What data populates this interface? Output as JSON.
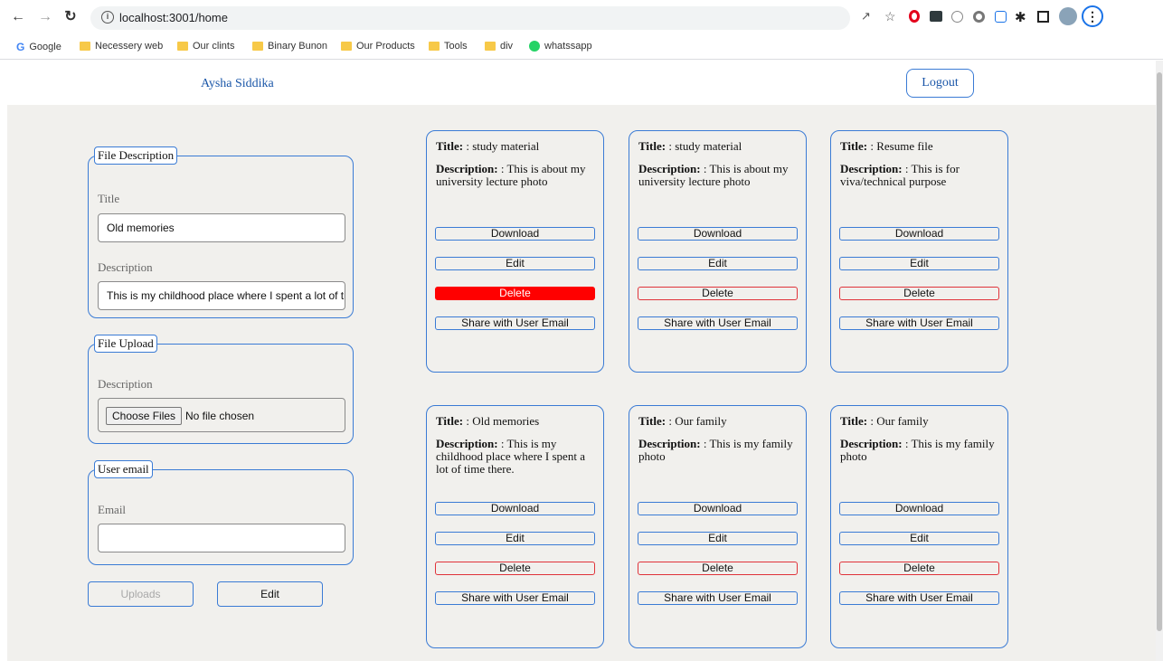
{
  "browser": {
    "url": "localhost:3001/home",
    "bookmarks": [
      "Google",
      "Necessery web",
      "Our clints",
      "Binary Bunon",
      "Our Products",
      "Tools",
      "div",
      "whatssapp"
    ]
  },
  "header": {
    "user_name": "Aysha Siddika",
    "logout_label": "Logout"
  },
  "forms": {
    "file_description": {
      "legend": "File Description",
      "title_label": "Title",
      "title_value": "Old memories",
      "description_label": "Description",
      "description_value": "This is my childhood place where I spent a lot of ti"
    },
    "file_upload": {
      "legend": "File Upload",
      "description_label": "Description",
      "choose_label": "Choose Files",
      "no_file_text": "No file chosen"
    },
    "user_email": {
      "legend": "User email",
      "email_label": "Email",
      "email_value": ""
    },
    "uploads_label": "Uploads",
    "edit_label": "Edit"
  },
  "card_labels": {
    "title": "Title:",
    "description": "Description:",
    "download": "Download",
    "edit": "Edit",
    "delete": "Delete",
    "share": "Share with User Email"
  },
  "cards": [
    {
      "title": ": study material",
      "description": ": This is about my university lecture photo",
      "delete_active": true
    },
    {
      "title": ": study material",
      "description": ": This is about my university lecture photo",
      "delete_active": false
    },
    {
      "title": ": Resume file",
      "description": ": This is for viva/technical purpose",
      "delete_active": false
    },
    {
      "title": ": Old memories",
      "description": ": This is my childhood place where I spent a lot of time there.",
      "delete_active": false
    },
    {
      "title": ": Our family",
      "description": ": This is my family photo",
      "delete_active": false
    },
    {
      "title": ": Our family",
      "description": ": This is my family photo",
      "delete_active": false
    }
  ],
  "colors": {
    "accent": "#3a7bd5",
    "delete_active": "#ff0000",
    "panel_bg": "#f1f0ed"
  }
}
